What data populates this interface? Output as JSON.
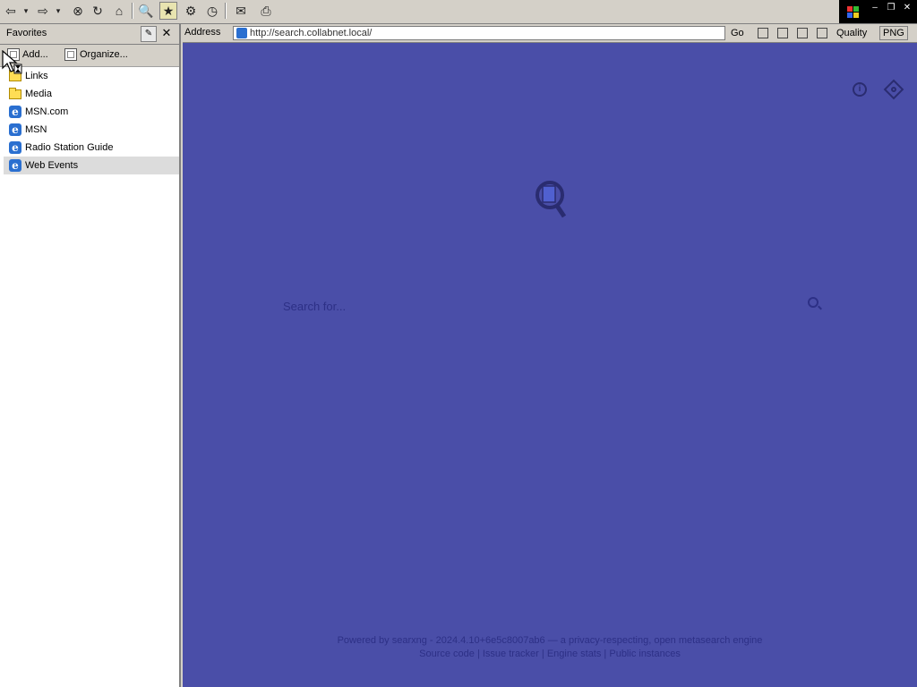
{
  "toolbar": {
    "buttons": [
      {
        "name": "back-button",
        "glyph": "⇦"
      },
      {
        "name": "back-dropdown",
        "glyph": "▾"
      },
      {
        "name": "forward-button",
        "glyph": "⇨"
      },
      {
        "name": "forward-dropdown",
        "glyph": "▾"
      },
      {
        "name": "stop-button",
        "glyph": "⊗"
      },
      {
        "name": "refresh-button",
        "glyph": "↻"
      },
      {
        "name": "home-button",
        "glyph": "⌂"
      },
      {
        "name": "search-button",
        "glyph": "🔍"
      },
      {
        "name": "favorites-button",
        "glyph": "★"
      },
      {
        "name": "media-button",
        "glyph": "⚙"
      },
      {
        "name": "history-button",
        "glyph": "◷"
      },
      {
        "name": "mail-button",
        "glyph": "✉"
      },
      {
        "name": "print-button",
        "glyph": "⎙"
      }
    ]
  },
  "favorites": {
    "title": "Favorites",
    "add_label": "Add...",
    "organize_label": "Organize...",
    "items": [
      {
        "label": "Links",
        "icon": "folder-icon"
      },
      {
        "label": "Media",
        "icon": "folder-icon"
      },
      {
        "label": "MSN.com",
        "icon": "ie-page-icon"
      },
      {
        "label": "MSN",
        "icon": "ie-page-icon"
      },
      {
        "label": "Radio Station Guide",
        "icon": "ie-page-icon"
      },
      {
        "label": "Web Events",
        "icon": "ie-page-icon",
        "selected": true
      }
    ]
  },
  "address": {
    "label": "Address",
    "url": "http://search.collabnet.local/",
    "go_label": "Go",
    "quality_label": "Quality",
    "format_label": "PNG"
  },
  "page": {
    "search_placeholder": "Search for...",
    "footer_line1": "Powered by searxng - 2024.4.10+6e5c8007ab6 — a privacy-respecting, open metasearch engine",
    "footer_links": [
      "Source code",
      "Issue tracker",
      "Engine stats",
      "Public instances"
    ],
    "bg_color": "#4a4ea8"
  }
}
